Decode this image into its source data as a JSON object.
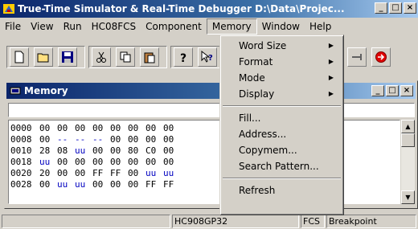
{
  "window": {
    "title": "True-Time Simulator & Real-Time Debugger  D:\\Data\\Projec...",
    "minimize": "_",
    "maximize": "□",
    "close": "×"
  },
  "menubar": {
    "items": [
      "File",
      "View",
      "Run",
      "HC08FCS",
      "Component",
      "Memory",
      "Window",
      "Help"
    ],
    "open_item": "Memory"
  },
  "memory_menu": {
    "items": [
      {
        "label": "Word Size",
        "submenu": true
      },
      {
        "label": "Format",
        "submenu": true
      },
      {
        "label": "Mode",
        "submenu": true
      },
      {
        "label": "Display",
        "submenu": true
      },
      {
        "label": "Fill...",
        "submenu": false
      },
      {
        "label": "Address...",
        "submenu": false
      },
      {
        "label": "Copymem...",
        "submenu": false
      },
      {
        "label": "Search Pattern...",
        "submenu": false
      },
      {
        "label": "Refresh",
        "submenu": false
      }
    ]
  },
  "memory_window": {
    "title": "Memory",
    "rows": [
      {
        "addr": "0000",
        "bytes": [
          "00",
          "00",
          "00",
          "00",
          "00",
          "00",
          "00",
          "00"
        ]
      },
      {
        "addr": "0008",
        "bytes": [
          "00",
          "--",
          "--",
          "--",
          "00",
          "00",
          "00",
          "00"
        ]
      },
      {
        "addr": "0010",
        "bytes": [
          "28",
          "08",
          "uu",
          "00",
          "00",
          "80",
          "C0",
          "00"
        ]
      },
      {
        "addr": "0018",
        "bytes": [
          "uu",
          "00",
          "00",
          "00",
          "00",
          "00",
          "00",
          "00"
        ]
      },
      {
        "addr": "0020",
        "bytes": [
          "20",
          "00",
          "00",
          "FF",
          "FF",
          "00",
          "uu",
          "uu"
        ]
      },
      {
        "addr": "0028",
        "bytes": [
          "00",
          "uu",
          "uu",
          "00",
          "00",
          "00",
          "FF",
          "FF"
        ]
      }
    ]
  },
  "statusbar": {
    "device": "HC908GP32",
    "connection": "FCS",
    "state": "Breakpoint"
  },
  "colors": {
    "title_gradient_start": "#0a246a",
    "title_gradient_end": "#a6caf0",
    "undefined_byte": "#0000c0"
  }
}
